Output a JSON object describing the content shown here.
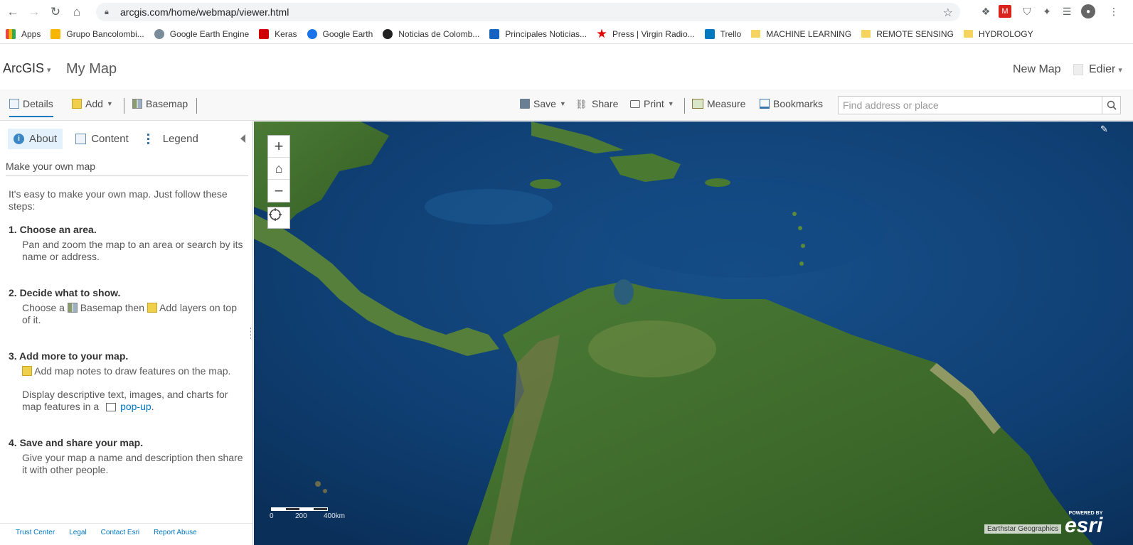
{
  "browser": {
    "url": "arcgis.com/home/webmap/viewer.html",
    "bookmarks": [
      {
        "label": "Apps",
        "color": "#e8453c"
      },
      {
        "label": "Grupo Bancolombi...",
        "color": "#f7b500"
      },
      {
        "label": "Google Earth Engine",
        "color": "#7a8b99"
      },
      {
        "label": "Keras",
        "color": "#d00000"
      },
      {
        "label": "Google Earth",
        "color": "#1a73e8"
      },
      {
        "label": "Noticias de Colomb...",
        "color": "#222222"
      },
      {
        "label": "Principales Noticias...",
        "color": "#1565c0"
      },
      {
        "label": "Press | Virgin Radio...",
        "color": "#e00000"
      },
      {
        "label": "Trello",
        "color": "#0079bf"
      },
      {
        "label": "MACHINE LEARNING",
        "color": "folder"
      },
      {
        "label": "REMOTE SENSING",
        "color": "folder"
      },
      {
        "label": "HYDROLOGY",
        "color": "folder"
      }
    ]
  },
  "header": {
    "brand": "ArcGIS",
    "title": "My Map",
    "new_map": "New Map",
    "user": "Edier"
  },
  "toolbar": {
    "details": "Details",
    "add": "Add",
    "basemap": "Basemap",
    "save": "Save",
    "share": "Share",
    "print": "Print",
    "measure": "Measure",
    "bookmarks": "Bookmarks",
    "search_placeholder": "Find address or place"
  },
  "panel": {
    "tabs": [
      "About",
      "Content",
      "Legend"
    ],
    "subtitle": "Make your own map",
    "intro": "It's easy to make your own map. Just follow these steps:",
    "steps": [
      {
        "title": "1. Choose an area.",
        "text": "Pan and zoom the map to an area or search by its name or address."
      },
      {
        "title": "2. Decide what to show.",
        "text_a": "Choose a",
        "text_b": "Basemap then",
        "text_c": "Add layers on top of it."
      },
      {
        "title": "3. Add more to your map.",
        "text_a": "Add map notes to draw features on the map.",
        "text_b": "Display descriptive text, images, and charts for map features in a",
        "link": "pop-up",
        "text_c": "."
      },
      {
        "title": "4. Save and share your map.",
        "text": "Give your map a name and description then share it with other people."
      }
    ],
    "footer": [
      "Trust Center",
      "Legal",
      "Contact Esri",
      "Report Abuse"
    ]
  },
  "map": {
    "scale_labels": [
      "0",
      "200",
      "400km"
    ],
    "attribution": "Earthstar Geographics",
    "powered_by": "POWERED BY",
    "esri": "esri"
  },
  "colors": {
    "accent": "#0079c1",
    "active_tab": "#e2f1fb",
    "ocean_deep": "#0d3a6e",
    "land": "#3f6b2a"
  }
}
